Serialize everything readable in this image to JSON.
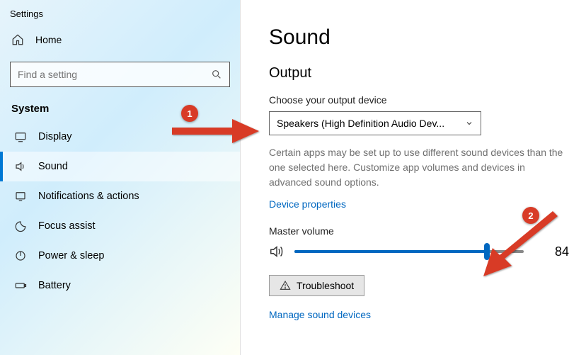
{
  "window_title": "Settings",
  "home_label": "Home",
  "search_placeholder": "Find a setting",
  "sidebar_section": "System",
  "nav": {
    "display": "Display",
    "sound": "Sound",
    "notifications": "Notifications & actions",
    "focus": "Focus assist",
    "power": "Power & sleep",
    "battery": "Battery"
  },
  "page": {
    "title": "Sound",
    "output_heading": "Output",
    "choose_label": "Choose your output device",
    "device_selected": "Speakers (High Definition Audio Dev...",
    "help_text": "Certain apps may be set up to use different sound devices than the one selected here. Customize app volumes and devices in advanced sound options.",
    "device_properties": "Device properties",
    "master_volume_label": "Master volume",
    "volume_value": "84",
    "troubleshoot_label": "Troubleshoot",
    "manage_label": "Manage sound devices"
  },
  "annotations": {
    "badge1": "1",
    "badge2": "2"
  }
}
